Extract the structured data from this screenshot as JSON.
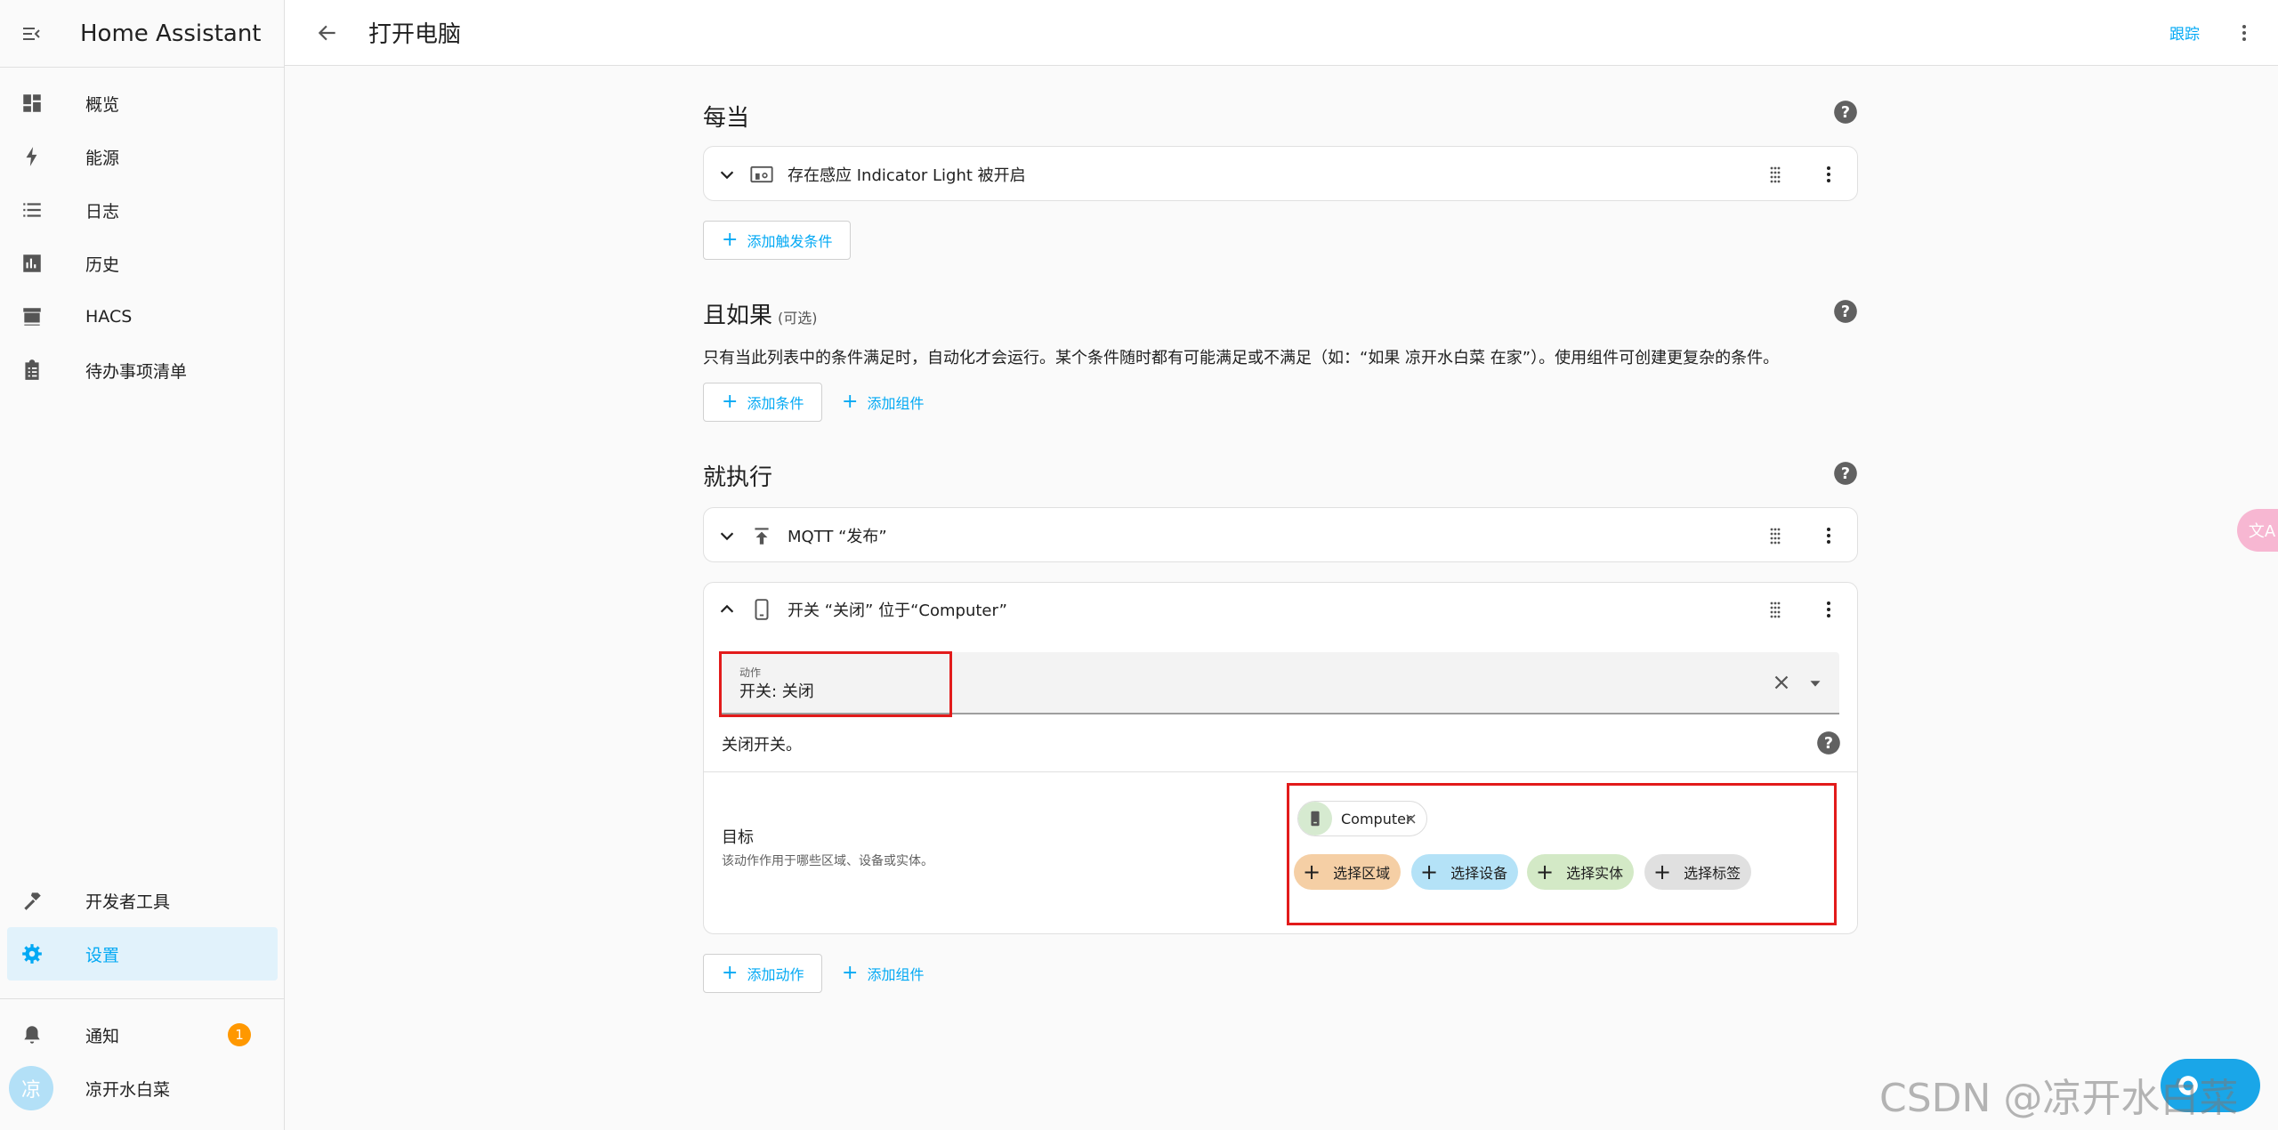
{
  "app": {
    "title": "Home Assistant"
  },
  "sidebar": {
    "items": [
      {
        "label": "概览",
        "icon": "dashboard-icon"
      },
      {
        "label": "能源",
        "icon": "lightning-icon"
      },
      {
        "label": "日志",
        "icon": "list-icon"
      },
      {
        "label": "历史",
        "icon": "chart-icon"
      },
      {
        "label": "HACS",
        "icon": "hacs-icon"
      },
      {
        "label": "待办事项清单",
        "icon": "clipboard-icon"
      }
    ],
    "developer_tools": "开发者工具",
    "settings": "设置",
    "notifications": "通知",
    "notifications_count": "1",
    "user_name": "凉开水白菜",
    "user_initial": "凉"
  },
  "header": {
    "title": "打开电脑",
    "follow_label": "跟踪"
  },
  "triggers": {
    "title": "每当",
    "items": [
      {
        "label": "存在感应 Indicator Light 被开启"
      }
    ],
    "add_label": "添加触发条件"
  },
  "conditions": {
    "title": "且如果",
    "optional": "(可选)",
    "description": "只有当此列表中的条件满足时，自动化才会运行。某个条件随时都有可能满足或不满足（如：“如果 凉开水白菜 在家”）。使用组件可创建更复杂的条件。",
    "add_condition": "添加条件",
    "add_block": "添加组件"
  },
  "actions": {
    "title": "就执行",
    "items": [
      {
        "label": "MQTT “发布”"
      },
      {
        "label": "开关 “关闭” 位于“Computer”"
      }
    ],
    "action_field": {
      "label": "动作",
      "value": "开关: 关闭"
    },
    "action_description": "关闭开关。",
    "target": {
      "title": "目标",
      "description": "该动作作用于哪些区域、设备或实体。",
      "entity": "Computer",
      "chips": [
        {
          "label": "选择区域",
          "color": "#f5cfa5"
        },
        {
          "label": "选择设备",
          "color": "#b4e2f7"
        },
        {
          "label": "选择实体",
          "color": "#d3e9c6"
        },
        {
          "label": "选择标签",
          "color": "#e0e0e0"
        }
      ]
    },
    "add_action": "添加动作",
    "add_block": "添加组件"
  },
  "colors": {
    "accent": "#03a9f4",
    "highlight": "#e21b1b",
    "badge": "#ff9800"
  },
  "watermark": "CSDN @凉开水白菜"
}
